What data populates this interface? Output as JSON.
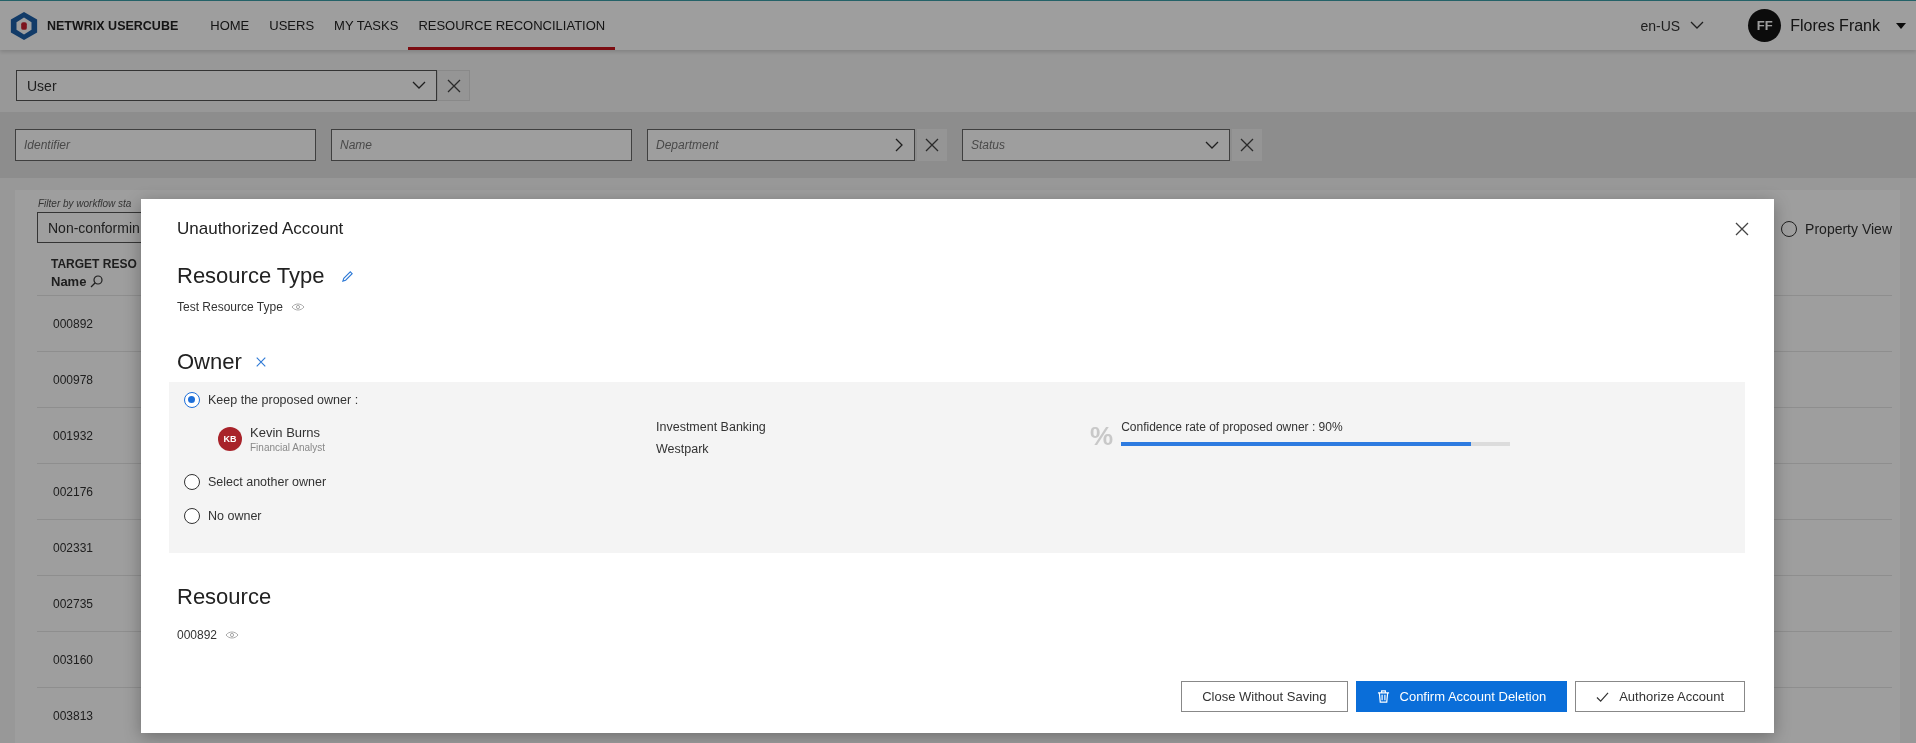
{
  "header": {
    "brand": "NETWRIX USERCUBE",
    "nav": [
      {
        "label": "HOME",
        "selected": false
      },
      {
        "label": "USERS",
        "selected": false
      },
      {
        "label": "MY TASKS",
        "selected": false
      },
      {
        "label": "RESOURCE RECONCILIATION",
        "selected": true
      }
    ],
    "language": "en-US",
    "user": {
      "initials": "FF",
      "name": "Flores Frank"
    }
  },
  "entity_select": {
    "value": "User"
  },
  "filters": [
    {
      "placeholder": "Identifier",
      "kind": "text"
    },
    {
      "placeholder": "Name",
      "kind": "text"
    },
    {
      "placeholder": "Department",
      "kind": "picker"
    },
    {
      "placeholder": "Status",
      "kind": "dropdown"
    }
  ],
  "table": {
    "filter_label": "Filter by workflow sta",
    "filter_value": "Non-conformin",
    "column_group": "TARGET RESO",
    "column": "Name",
    "rows": [
      "000892",
      "000978",
      "001932",
      "002176",
      "002331",
      "002735",
      "003160",
      "003813"
    ]
  },
  "view_option": {
    "label": "Property View",
    "selected": false
  },
  "dialog": {
    "title": "Unauthorized Account",
    "resource_type": {
      "heading": "Resource Type",
      "value": "Test Resource Type"
    },
    "owner": {
      "heading": "Owner",
      "options": [
        {
          "label": "Keep the proposed owner :",
          "selected": true
        },
        {
          "label": "Select another owner",
          "selected": false
        },
        {
          "label": "No owner",
          "selected": false
        }
      ],
      "proposed": {
        "initials": "KB",
        "name": "Kevin Burns",
        "title": "Financial Analyst",
        "department": "Investment Banking",
        "location": "Westpark",
        "confidence_icon": "%",
        "confidence_label": "Confidence rate of proposed owner : 90%",
        "level": 0.9
      }
    },
    "resource": {
      "heading": "Resource",
      "value": "000892"
    },
    "buttons": [
      {
        "label": "Close Without Saving",
        "kind": "plain"
      },
      {
        "label": "Confirm Account Deletion",
        "kind": "delete"
      },
      {
        "label": "Authorize Account",
        "kind": "authorize"
      }
    ]
  }
}
